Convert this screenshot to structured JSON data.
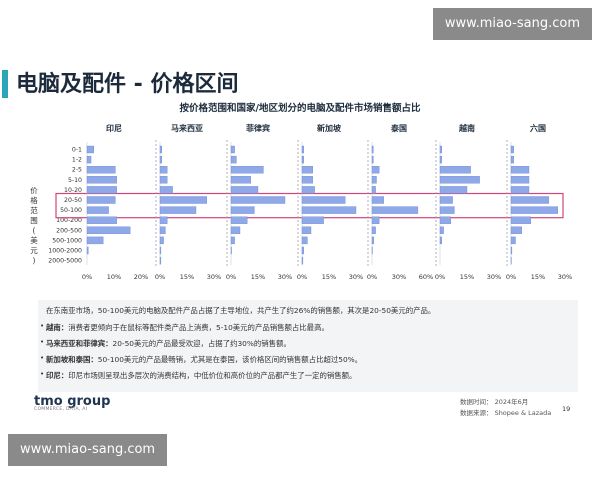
{
  "watermark": "www.miao-sang.com",
  "page_title": "电脑及配件 - 价格区间",
  "chart_data": {
    "type": "bar",
    "orientation": "horizontal",
    "title": "按价格范围和国家/地区划分的电脑及配件市场销售额占比",
    "ylabel": "价格范围（美元）",
    "categories": [
      "0-1",
      "1-2",
      "2-5",
      "5-10",
      "10-20",
      "20-50",
      "50-100",
      "100-200",
      "200-500",
      "500-1000",
      "1000-2000",
      "2000-5000"
    ],
    "highlighted_categories": [
      "20-50",
      "50-100"
    ],
    "panels": [
      {
        "name": "印尼",
        "xlim": [
          0,
          20
        ],
        "ticks": [
          "0%",
          "10%",
          "20%"
        ],
        "values": [
          2.5,
          1.5,
          10.5,
          11,
          11,
          10.5,
          8,
          11,
          16,
          6,
          0.5,
          0
        ]
      },
      {
        "name": "马来西亚",
        "xlim": [
          0,
          30
        ],
        "ticks": [
          "0%",
          "15%",
          "30%"
        ],
        "values": [
          1,
          1,
          4,
          4,
          7,
          26,
          20,
          4,
          3,
          2,
          0.5,
          0.5
        ]
      },
      {
        "name": "菲律宾",
        "xlim": [
          0,
          30
        ],
        "ticks": [
          "0%",
          "15%",
          "30%"
        ],
        "values": [
          2,
          3,
          18,
          11,
          15,
          30,
          13,
          9,
          5,
          2,
          0.3,
          0
        ]
      },
      {
        "name": "新加坡",
        "xlim": [
          0,
          30
        ],
        "ticks": [
          "0%",
          "15%",
          "30%"
        ],
        "values": [
          1,
          1,
          6,
          6,
          7,
          24,
          30,
          12,
          5,
          3,
          1,
          0.5
        ]
      },
      {
        "name": "泰国",
        "xlim": [
          0,
          60
        ],
        "ticks": [
          "0%",
          "30%",
          "60%"
        ],
        "values": [
          1.5,
          1.5,
          8,
          5,
          4,
          13,
          51,
          8,
          4,
          2,
          0.5,
          0
        ]
      },
      {
        "name": "越南",
        "xlim": [
          0,
          30
        ],
        "ticks": [
          "0%",
          "15%",
          "30%"
        ],
        "values": [
          1,
          1,
          17,
          22,
          15,
          7,
          8,
          6,
          2,
          1,
          0,
          0
        ]
      },
      {
        "name": "六国",
        "xlim": [
          0,
          30
        ],
        "ticks": [
          "0%",
          "15%",
          "30%"
        ],
        "values": [
          1.5,
          1.5,
          10,
          10,
          10,
          21,
          26,
          11,
          6,
          2.5,
          0.5,
          0.2
        ]
      }
    ]
  },
  "notes": {
    "intro": "在东南亚市场，50-100美元的电脑及配件产品占据了主导地位，共产生了约26%的销售额，其次是20-50美元的产品。",
    "items": [
      {
        "label": "越南：",
        "text": "消费者更倾向于在鼠标等配件类产品上消费，5-10美元的产品销售额占比最高。"
      },
      {
        "label": "马来西亚和菲律宾：",
        "text": "20-50美元的产品最受欢迎，占据了约30%的销售额。"
      },
      {
        "label": "新加坡和泰国：",
        "text": "50-100美元的产品最畅销，尤其是在泰国，该价格区间的销售额占比超过50%。"
      },
      {
        "label": "印尼：",
        "text": "印尼市场则呈现出多层次的消费结构，中低价位和高价位的产品都产生了一定的销售额。"
      }
    ]
  },
  "footer": {
    "logo": "tmo group",
    "logo_sub": "COMMERCE, DATA, AI",
    "data_time": "数据时间：  2024年6月",
    "data_source": "数据来源：  Shopee & Lazada",
    "page_number": "19"
  },
  "colors": {
    "bar": "#8fa8e8",
    "bar_stroke": "#6f8bd8",
    "highlight": "#d0457a",
    "accent": "#2aa6b8",
    "divider": "#9aa0a6"
  }
}
